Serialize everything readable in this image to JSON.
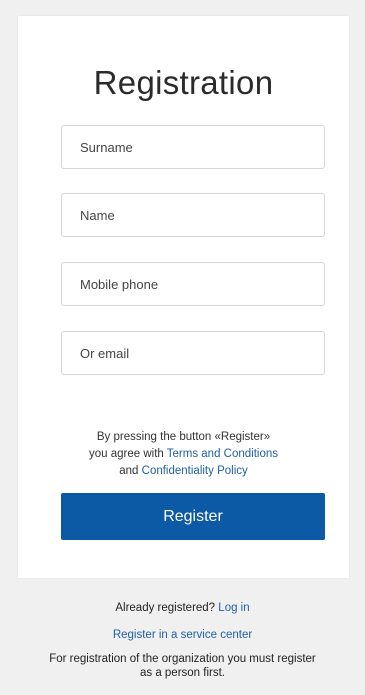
{
  "form": {
    "title": "Registration",
    "surname_placeholder": "Surname",
    "name_placeholder": "Name",
    "phone_placeholder": "Mobile phone",
    "email_placeholder": "Or email",
    "agree_prefix": "By pressing the button «Register»",
    "agree_mid": "you agree with",
    "terms_link": "Terms and Conditions",
    "agree_and": "and",
    "privacy_link": "Confidentiality Policy",
    "register_label": "Register"
  },
  "footer": {
    "already_text": "Already registered?",
    "login_link": "Log in",
    "service_center_link": "Register in a service center",
    "org_note_line1": "For registration of the organization you must register",
    "org_note_line2": "as a person first."
  },
  "colors": {
    "accent": "#0c5aa6",
    "link": "#1f5fa6",
    "background": "#f0f0f0"
  }
}
